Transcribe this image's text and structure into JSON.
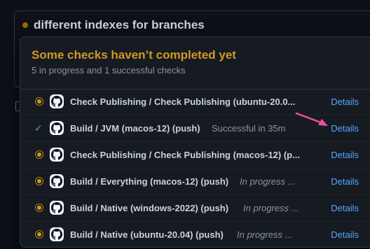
{
  "pr": {
    "title": "different indexes for branches"
  },
  "popover": {
    "title": "Some checks haven’t completed yet",
    "subtitle": "5 in progress and 1 successful checks",
    "checks": [
      {
        "name": "Check Publishing / Check Publishing (ubuntu-20.0...",
        "status_text": "",
        "state": "in-progress",
        "details": "Details"
      },
      {
        "name": "Build / JVM (macos-12) (push)",
        "status_text": "Successful in 35m",
        "state": "success",
        "details": "Details"
      },
      {
        "name": "Check Publishing / Check Publishing (macos-12) (p...",
        "status_text": "",
        "state": "in-progress",
        "details": "Details"
      },
      {
        "name": "Build / Everything (macos-12) (push)",
        "status_text": "In progress ...",
        "state": "in-progress",
        "details": "Details"
      },
      {
        "name": "Build / Native (windows-2022) (push)",
        "status_text": "In progress ...",
        "state": "in-progress",
        "details": "Details"
      },
      {
        "name": "Build / Native (ubuntu-20.04) (push)",
        "status_text": "In progress ...",
        "state": "in-progress",
        "details": "Details"
      }
    ]
  },
  "icons": {
    "in_progress": "dot-fill-icon",
    "success": "check-icon",
    "avatar": "github-octocat-icon"
  },
  "colors": {
    "warning": "#d29922",
    "success": "#3fb950",
    "link": "#58a6ff",
    "annotation_arrow": "#f0509a"
  }
}
